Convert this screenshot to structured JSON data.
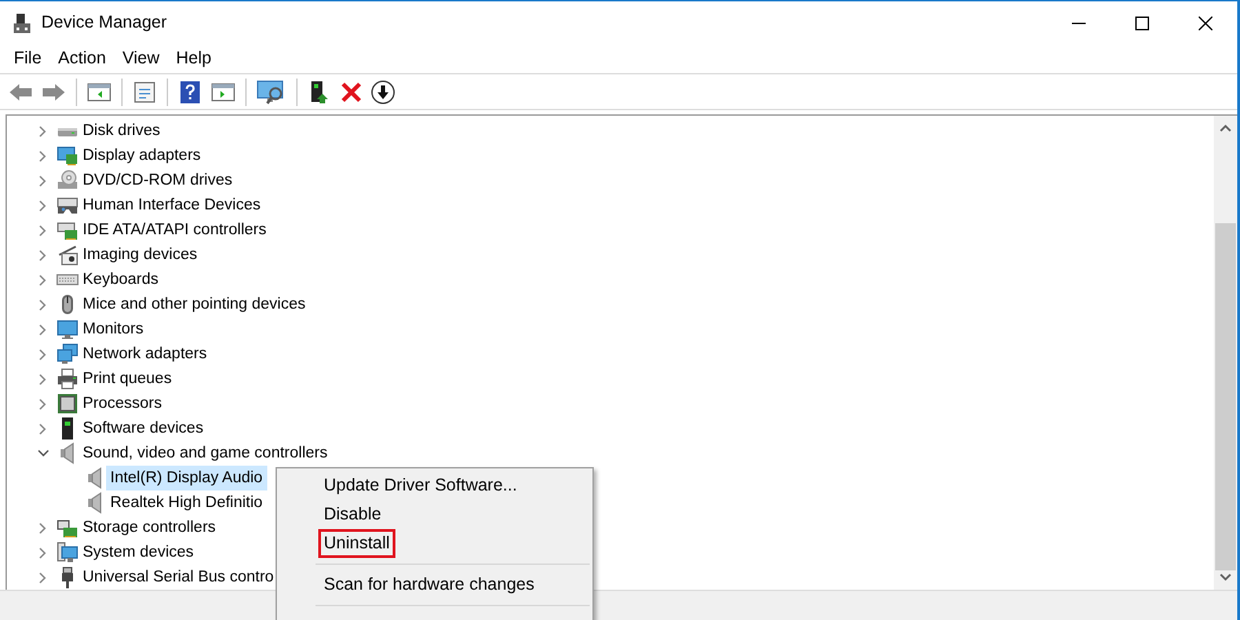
{
  "window": {
    "title": "Device Manager"
  },
  "menu": [
    "File",
    "Action",
    "View",
    "Help"
  ],
  "tree": [
    {
      "label": "Disk drives",
      "kind": "drive",
      "expanded": false
    },
    {
      "label": "Display adapters",
      "kind": "display",
      "expanded": false
    },
    {
      "label": "DVD/CD-ROM drives",
      "kind": "disc",
      "expanded": false
    },
    {
      "label": "Human Interface Devices",
      "kind": "hid",
      "expanded": false
    },
    {
      "label": "IDE ATA/ATAPI controllers",
      "kind": "controller",
      "expanded": false
    },
    {
      "label": "Imaging devices",
      "kind": "camera",
      "expanded": false
    },
    {
      "label": "Keyboards",
      "kind": "keyboard",
      "expanded": false
    },
    {
      "label": "Mice and other pointing devices",
      "kind": "mouse",
      "expanded": false
    },
    {
      "label": "Monitors",
      "kind": "monitor",
      "expanded": false
    },
    {
      "label": "Network adapters",
      "kind": "network",
      "expanded": false
    },
    {
      "label": "Print queues",
      "kind": "printer",
      "expanded": false
    },
    {
      "label": "Processors",
      "kind": "chip",
      "expanded": false
    },
    {
      "label": "Software devices",
      "kind": "software",
      "expanded": false
    },
    {
      "label": "Sound, video and game controllers",
      "kind": "speaker",
      "expanded": true,
      "children": [
        {
          "label": "Intel(R) Display Audio",
          "kind": "speaker",
          "selected": true
        },
        {
          "label": "Realtek High Definitio",
          "kind": "speaker",
          "selected": false
        }
      ]
    },
    {
      "label": "Storage controllers",
      "kind": "storage",
      "expanded": false
    },
    {
      "label": "System devices",
      "kind": "system",
      "expanded": false
    },
    {
      "label": "Universal Serial Bus contro",
      "kind": "usb",
      "expanded": false
    }
  ],
  "context_menu": [
    [
      {
        "label": "Update Driver Software...",
        "highlighted": false
      },
      {
        "label": "Disable",
        "highlighted": false
      },
      {
        "label": "Uninstall",
        "highlighted": true
      }
    ],
    [
      {
        "label": "Scan for hardware changes",
        "highlighted": false
      }
    ]
  ]
}
